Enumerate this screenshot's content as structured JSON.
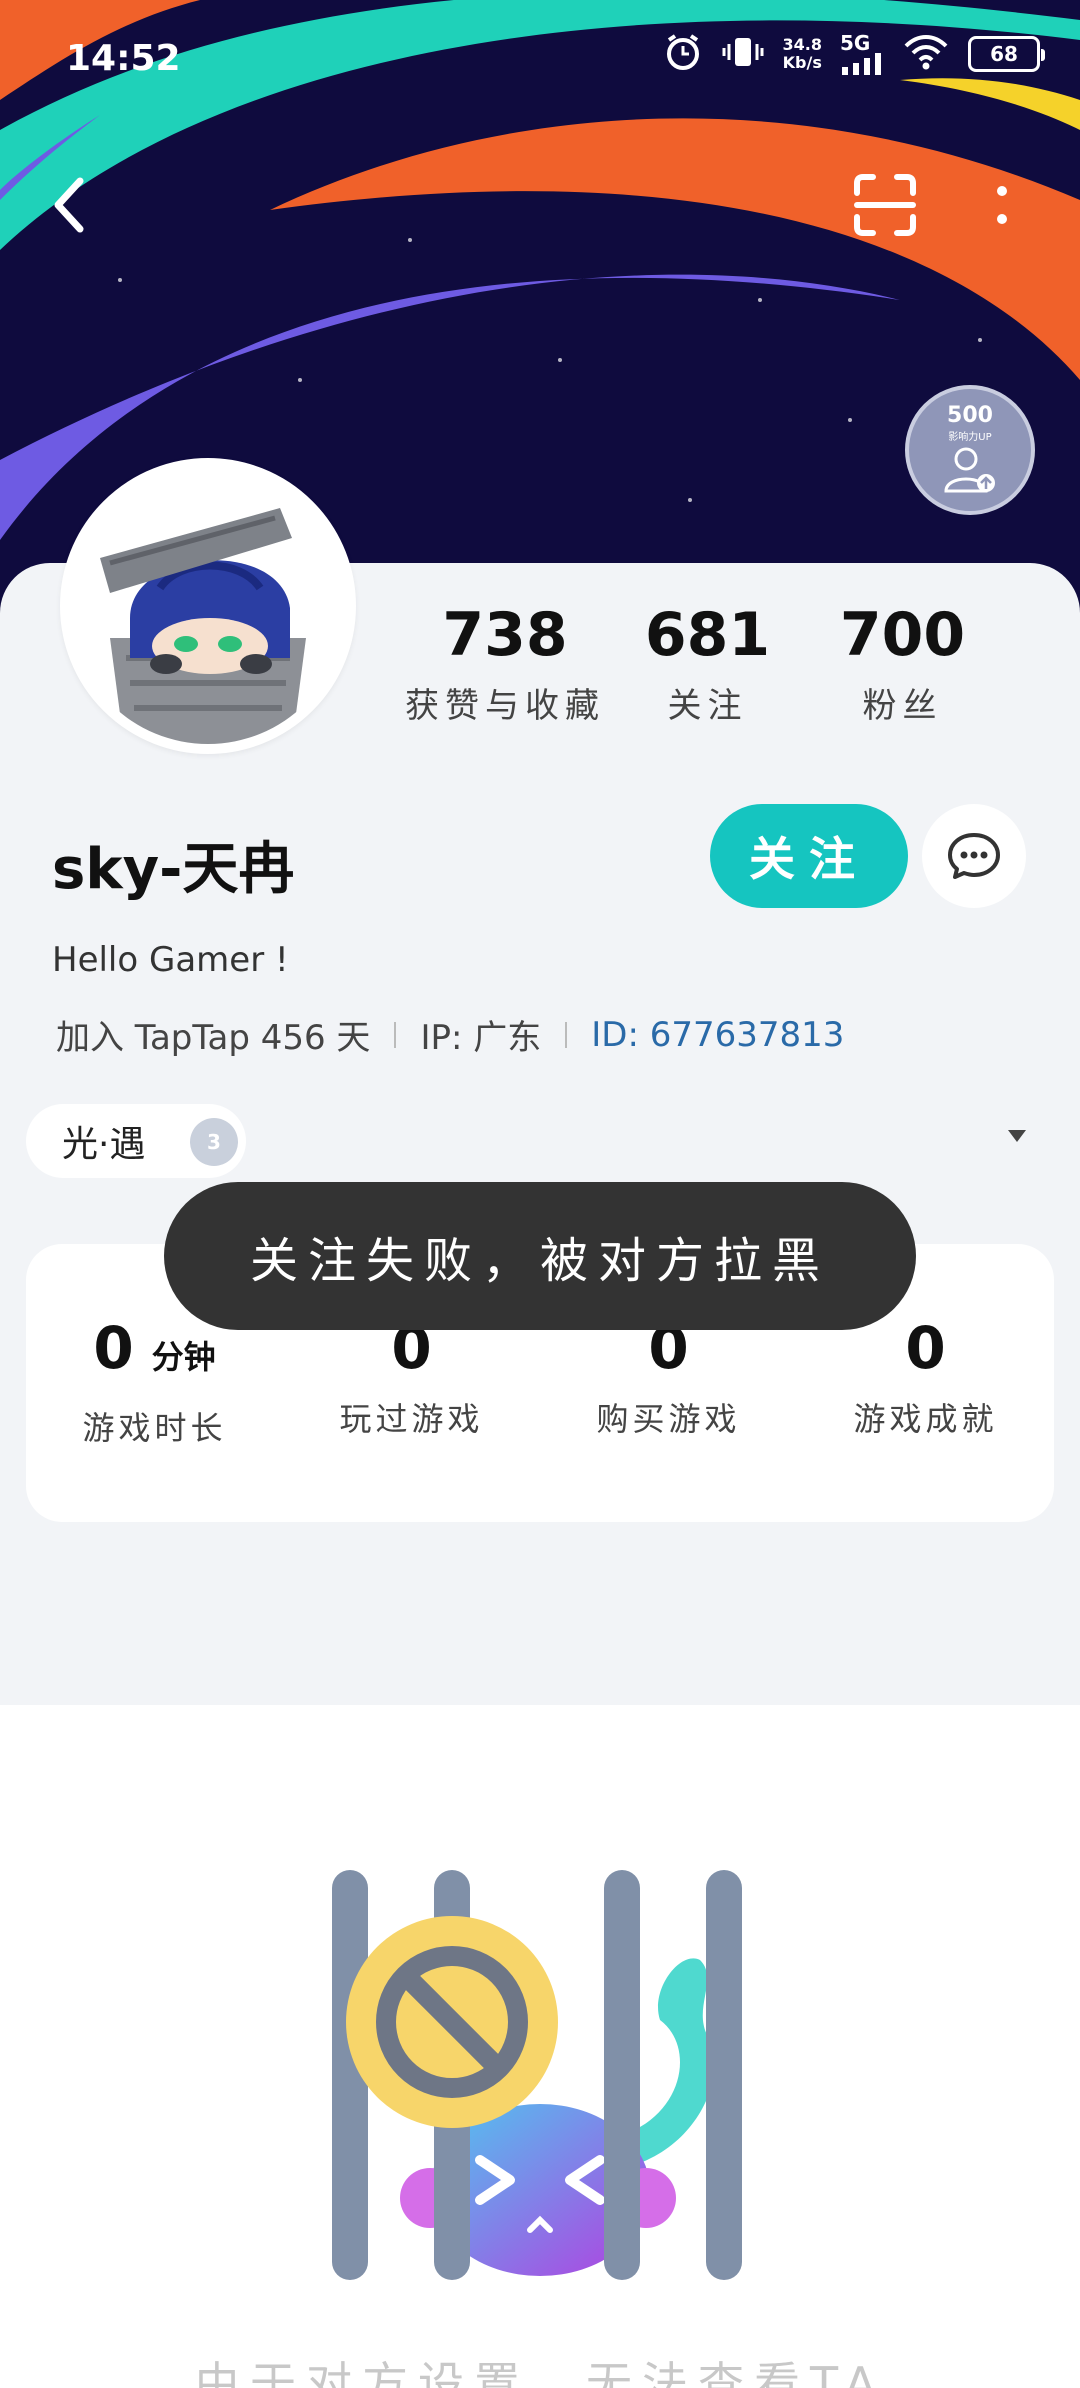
{
  "status_bar": {
    "time": "14:52",
    "net_speed": "34.8",
    "net_unit": "Kb/s",
    "network": "5G",
    "battery": "68"
  },
  "profile": {
    "stats": [
      {
        "value": "738",
        "label": "获赞与收藏"
      },
      {
        "value": "681",
        "label": "关注"
      },
      {
        "value": "700",
        "label": "粉丝"
      }
    ],
    "username": "sky-天冉",
    "follow_label": "关注",
    "bio": "Hello Gamer !",
    "joined": "加入 TapTap 456 天",
    "ip": "IP: 广东",
    "id": "ID: 677637813",
    "badge_value": "500",
    "badge_sub": "影响力UP"
  },
  "game_tag": {
    "name": "光·遇",
    "level": "3"
  },
  "game_stats": [
    {
      "value": "0",
      "unit": "分钟",
      "label": "游戏时长"
    },
    {
      "value": "0",
      "unit": "",
      "label": "玩过游戏"
    },
    {
      "value": "0",
      "unit": "",
      "label": "购买游戏"
    },
    {
      "value": "0",
      "unit": "",
      "label": "游戏成就"
    }
  ],
  "toast": "关注失败，被对方拉黑",
  "blocked_message": "由于对方设置，无法查看TA",
  "colors": {
    "accent": "#15c5c0",
    "banner_bg": "#0f0b3e",
    "sheet_bg": "#f2f4f7",
    "id_link": "#2a6aa8"
  }
}
